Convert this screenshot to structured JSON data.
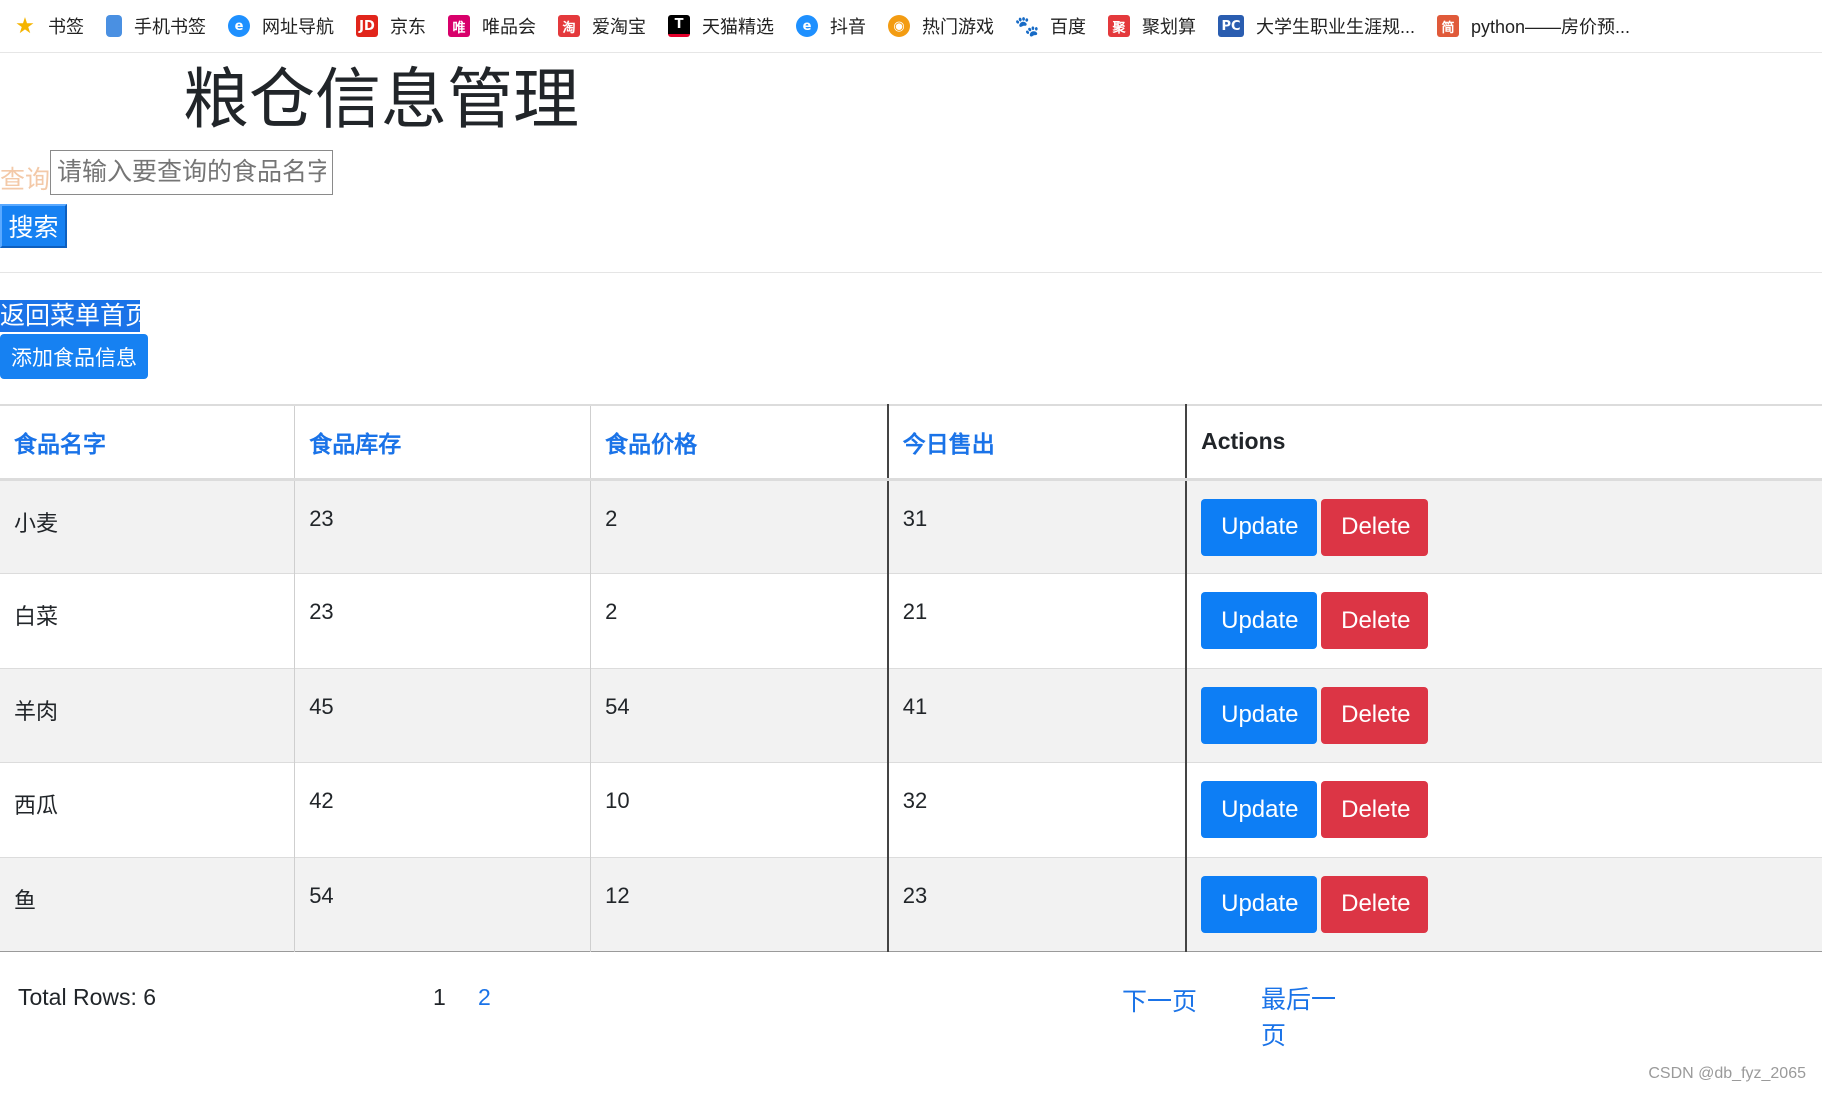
{
  "bookmarks": [
    {
      "label": "书签",
      "icon": "star-icon",
      "glyph": "★",
      "cls": "star"
    },
    {
      "label": "手机书签",
      "icon": "phone-icon",
      "glyph": "",
      "cls": "phone"
    },
    {
      "label": "网址导航",
      "icon": "browser-icon",
      "glyph": "e",
      "cls": "edge"
    },
    {
      "label": "京东",
      "icon": "jd-icon",
      "glyph": "JD",
      "cls": "jd"
    },
    {
      "label": "唯品会",
      "icon": "vip-icon",
      "glyph": "唯",
      "cls": "vip"
    },
    {
      "label": "爱淘宝",
      "icon": "taobao-icon",
      "glyph": "淘",
      "cls": "taobao"
    },
    {
      "label": "天猫精选",
      "icon": "tmall-icon",
      "glyph": "T",
      "cls": "tmall"
    },
    {
      "label": "抖音",
      "icon": "douyin-icon",
      "glyph": "e",
      "cls": "douyin"
    },
    {
      "label": "热门游戏",
      "icon": "game-icon",
      "glyph": "◉",
      "cls": "game"
    },
    {
      "label": "百度",
      "icon": "baidu-icon",
      "glyph": "🐾",
      "cls": "baidu"
    },
    {
      "label": "聚划算",
      "icon": "juhuasuan-icon",
      "glyph": "聚",
      "cls": "ju"
    },
    {
      "label": "大学生职业生涯规...",
      "icon": "pc-icon",
      "glyph": "PC",
      "cls": "pc"
    },
    {
      "label": "python——房价预...",
      "icon": "jian-icon",
      "glyph": "简",
      "cls": "jian"
    }
  ],
  "page": {
    "title": "粮仓信息管理"
  },
  "search": {
    "label": "查询",
    "placeholder": "请输入要查询的食品名字",
    "button": "搜索"
  },
  "nav": {
    "back_link": "返回菜单首页",
    "add_button": "添加食品信息"
  },
  "table": {
    "headers": [
      "食品名字",
      "食品库存",
      "食品价格",
      "今日售出",
      "Actions"
    ],
    "rows": [
      {
        "name": "小麦",
        "stock": "23",
        "price": "2",
        "sold": "31"
      },
      {
        "name": "白菜",
        "stock": "23",
        "price": "2",
        "sold": "21"
      },
      {
        "name": "羊肉",
        "stock": "45",
        "price": "54",
        "sold": "41"
      },
      {
        "name": "西瓜",
        "stock": "42",
        "price": "10",
        "sold": "32"
      },
      {
        "name": "鱼",
        "stock": "54",
        "price": "12",
        "sold": "23"
      }
    ],
    "update_label": "Update",
    "delete_label": "Delete"
  },
  "pagination": {
    "total": "Total Rows: 6",
    "pages": [
      "1",
      "2"
    ],
    "next": "下一页",
    "last": "最后一页"
  },
  "watermark": "CSDN @db_fyz_2065",
  "colors": {
    "primary": "#0d7ef5",
    "danger": "#dc3545",
    "link": "#1a73e8"
  }
}
